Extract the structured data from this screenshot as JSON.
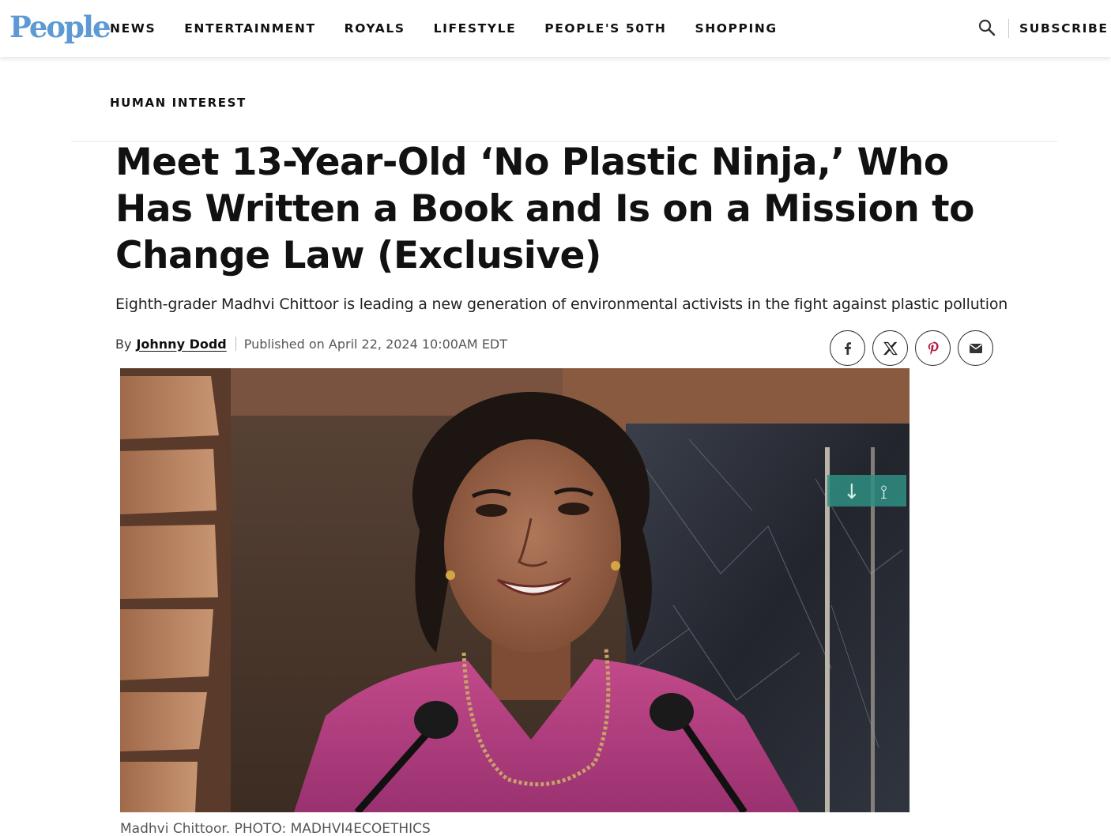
{
  "header": {
    "logo": "People",
    "nav": [
      "NEWS",
      "ENTERTAINMENT",
      "ROYALS",
      "LIFESTYLE",
      "PEOPLE'S 50TH",
      "SHOPPING"
    ],
    "subscribe": "SUBSCRIBE",
    "search_icon": "search-icon"
  },
  "article": {
    "category": "HUMAN INTEREST",
    "headline": "Meet 13-Year-Old ‘No Plastic Ninja,’ Who Has Written a Book and Is on a Mission to Change Law (Exclusive)",
    "dek": "Eighth-grader Madhvi Chittoor is leading a new generation of environmental activists in the fight against plastic pollution",
    "by_prefix": "By",
    "author": "Johnny Dodd",
    "published": "Published on April 22, 2024 10:00AM EDT",
    "share_icons": [
      "facebook-icon",
      "x-icon",
      "pinterest-icon",
      "email-icon"
    ],
    "caption": "Madhvi Chittoor. PHOTO: MADHVI4ECOETHICS"
  },
  "colors": {
    "logo": "#5d9ad4",
    "text": "#111111",
    "shirt": "#b8407f"
  }
}
